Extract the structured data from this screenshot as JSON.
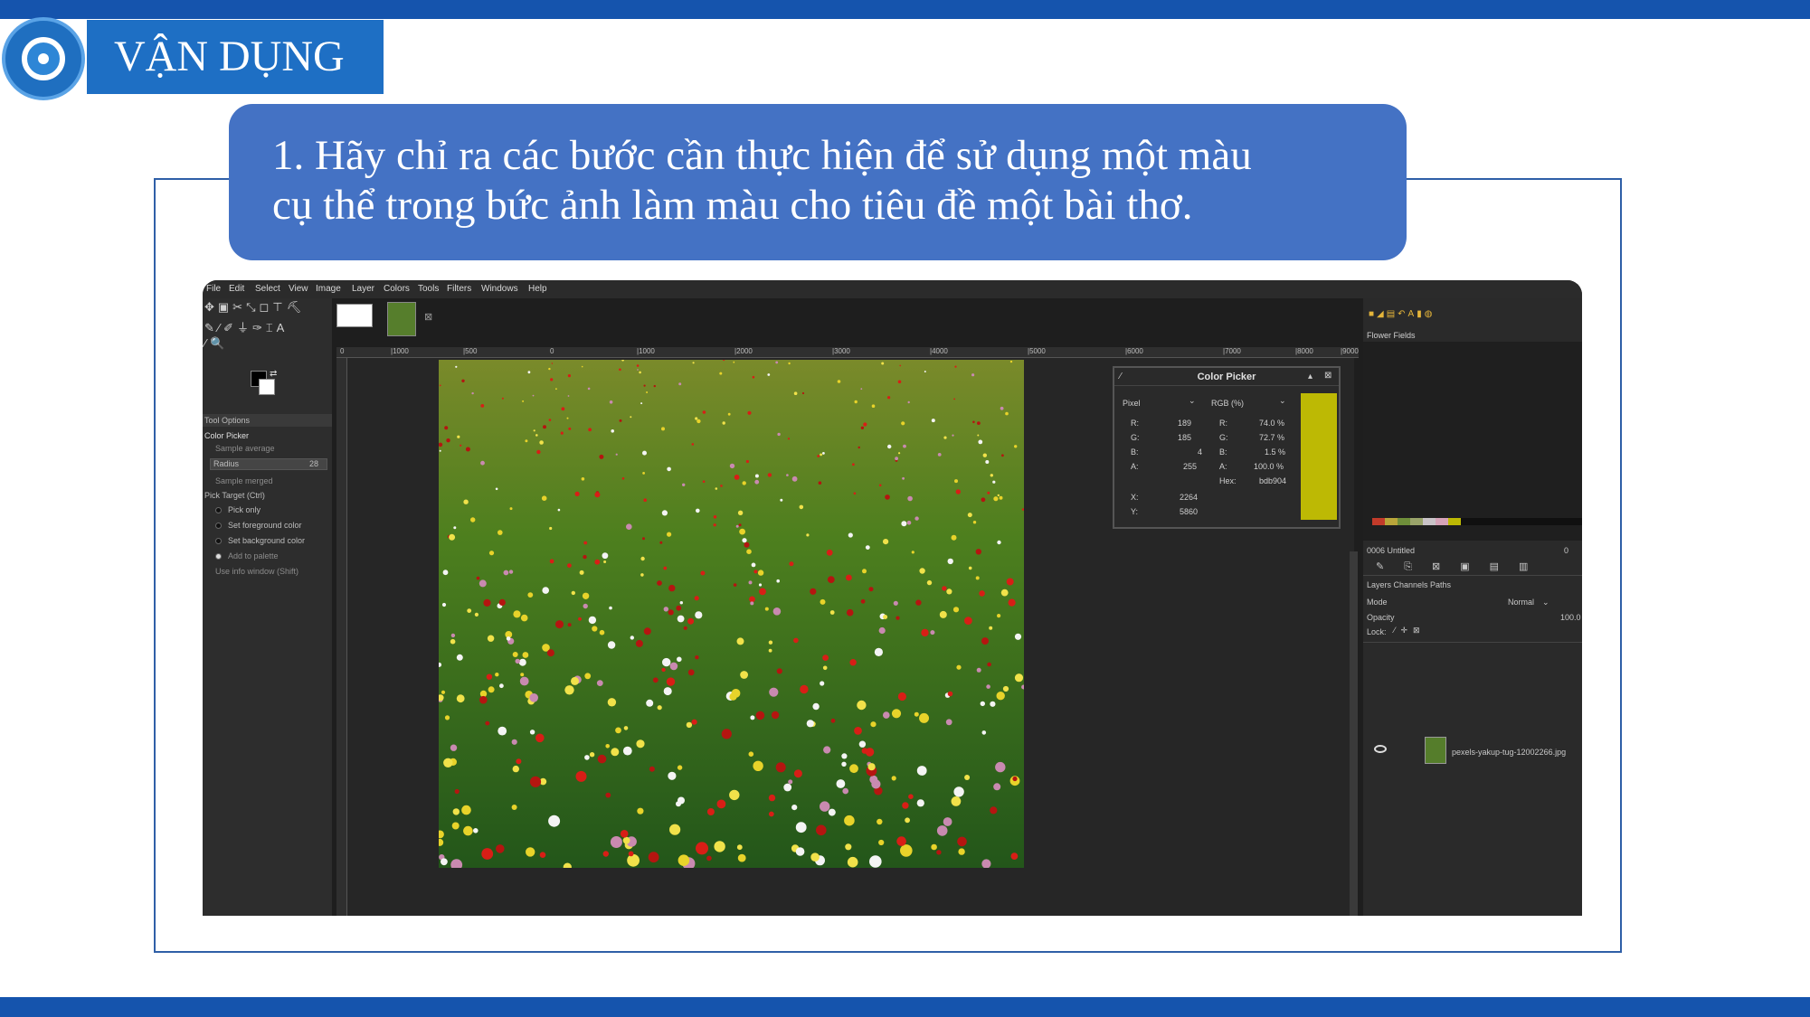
{
  "slide": {
    "section_title": "VẬN DỤNG",
    "question_line1": "1. Hãy chỉ ra các bước cần thực hiện để sử dụng một màu",
    "question_line2": "cụ thể trong bức ảnh làm màu cho tiêu đề một bài thơ."
  },
  "gimp": {
    "menu": [
      "File",
      "Edit",
      "Select",
      "View",
      "Image",
      "Layer",
      "Colors",
      "Tools",
      "Filters",
      "Windows",
      "Help"
    ],
    "tool_options": {
      "tab": "Tool Options",
      "tool_name": "Color Picker",
      "sample_average": "Sample average",
      "radius_label": "Radius",
      "radius_value": "28",
      "sample_merged": "Sample merged",
      "pick_target": "Pick Target  (Ctrl)",
      "options": [
        "Pick only",
        "Set foreground color",
        "Set background color",
        "Add to palette"
      ],
      "use_info_window": "Use info window  (Shift)"
    },
    "ruler_labels": [
      "0",
      "|1000",
      "|500",
      "0",
      "|1000",
      "|2000",
      "|3000",
      "|4000",
      "|5000",
      "|6000",
      "|7000",
      "|8000",
      "|9000"
    ],
    "color_picker": {
      "title": "Color Picker",
      "mode_left": "Pixel",
      "mode_right": "RGB (%)",
      "left_rows": [
        {
          "label": "R:",
          "value": "189"
        },
        {
          "label": "G:",
          "value": "185"
        },
        {
          "label": "B:",
          "value": "4"
        },
        {
          "label": "A:",
          "value": "255"
        }
      ],
      "right_rows": [
        {
          "label": "R:",
          "value": "74.0 %"
        },
        {
          "label": "G:",
          "value": "72.7 %"
        },
        {
          "label": "B:",
          "value": "1.5 %"
        },
        {
          "label": "A:",
          "value": "100.0 %"
        },
        {
          "label": "Hex:",
          "value": "bdb904"
        }
      ],
      "x_label": "X:",
      "x_value": "2264",
      "y_label": "Y:",
      "y_value": "5860",
      "swatch_color": "#bdb904"
    },
    "right_dock": {
      "palette_name": "Flower Fields",
      "palette_chips": [
        "#c23b2a",
        "#b9a63a",
        "#6f8f3a",
        "#9aa46a",
        "#c9c3c7",
        "#d6a3b8",
        "#bdb904"
      ],
      "palette_editor": "0006  Untitled",
      "palette_count": "0",
      "tabs": "Layers  Channels  Paths",
      "mode_label": "Mode",
      "mode_value": "Normal",
      "opacity_label": "Opacity",
      "opacity_value": "100.0",
      "lock_label": "Lock:",
      "layer_name": "pexels-yakup-tug-12002266.jpg"
    }
  },
  "colors": {
    "brand_blue": "#1554ad",
    "title_blue": "#1e6fc4",
    "question_bg": "#4472c4",
    "frame_border": "#2f5fa7"
  }
}
